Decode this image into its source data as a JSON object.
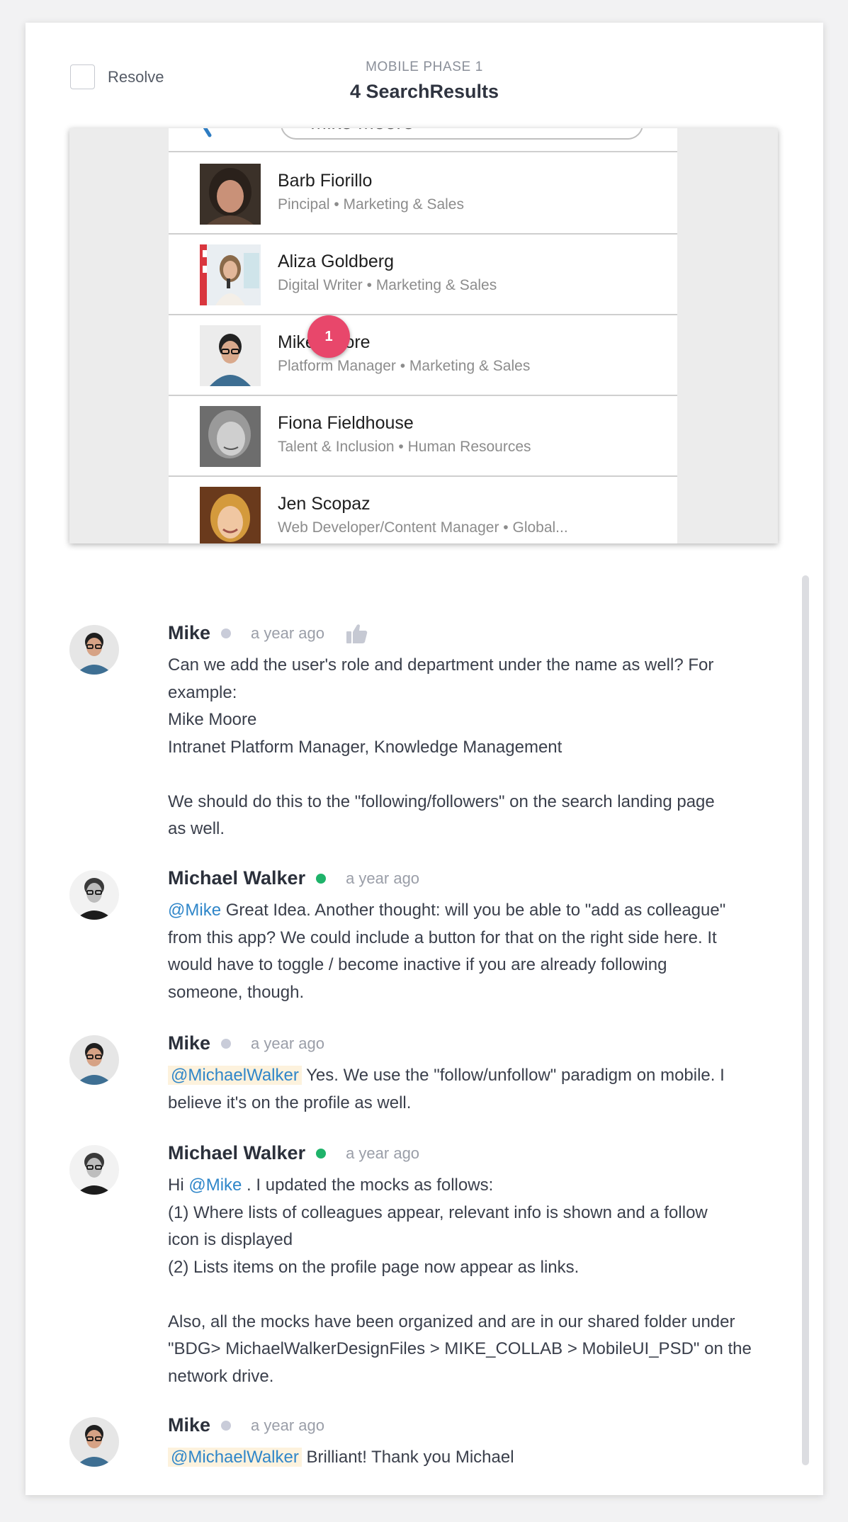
{
  "header": {
    "resolve_label": "Resolve",
    "phase": "MOBILE PHASE 1",
    "screen_title": "4 SearchResults"
  },
  "preview": {
    "search_text": "Mike Moore",
    "marker_number": "1",
    "people": [
      {
        "name": "Barb Fiorillo",
        "meta": "Pincipal • Marketing & Sales"
      },
      {
        "name": "Aliza Goldberg",
        "meta": "Digital Writer • Marketing & Sales"
      },
      {
        "name": "Mike Moore",
        "meta": "Platform Manager • Marketing & Sales"
      },
      {
        "name": "Fiona Fieldhouse",
        "meta": "Talent & Inclusion • Human Resources"
      },
      {
        "name": "Jen Scopaz",
        "meta": "Web Developer/Content Manager • Global..."
      }
    ]
  },
  "colors": {
    "marker": "#e8476b",
    "online": "#1fb36a",
    "offline": "#c9ccd9",
    "mention": "#2f86c9",
    "mention_bg": "#fdf2dd"
  },
  "comments": [
    {
      "author": "Mike",
      "status": "offline",
      "time": "a year ago",
      "lines": [
        "Can we add the user's role and department under the name as well? For",
        "example:",
        "Mike Moore",
        "Intranet Platform Manager, Knowledge Management",
        "",
        "We should do this to the \"following/followers\" on the search landing page",
        "as well."
      ]
    },
    {
      "author": "Michael Walker",
      "status": "online",
      "time": "a year ago",
      "mention": "@Mike",
      "line1_rest": " Great Idea. Another thought: will you be able to \"add as colleague\"",
      "lines": [
        "from this app? We could include a button for that on the right side here. It",
        "would have to toggle / become inactive if you are already following",
        "someone, though."
      ]
    },
    {
      "author": "Mike",
      "status": "offline",
      "time": "a year ago",
      "mention": "@MichaelWalker",
      "line1_rest": " Yes. We use the \"follow/unfollow\" paradigm on mobile. I",
      "lines": [
        "believe it's on the profile as well."
      ]
    },
    {
      "author": "Michael Walker",
      "status": "online",
      "time": "a year ago",
      "line1_pre": "Hi ",
      "mention": "@Mike",
      "line1_rest": " . I updated the mocks as follows:",
      "lines": [
        "(1) Where lists of colleagues appear, relevant info is shown and a follow",
        "icon is displayed",
        "(2) Lists items on the profile page now appear as links.",
        "",
        "Also, all the mocks have been organized and are in our shared folder under",
        "\"BDG> MichaelWalkerDesignFiles > MIKE_COLLAB > MobileUI_PSD\" on the",
        "network drive."
      ]
    },
    {
      "author": "Mike",
      "status": "offline",
      "time": "a year ago",
      "mention": "@MichaelWalker",
      "line1_rest": " Brilliant! Thank you Michael"
    }
  ]
}
